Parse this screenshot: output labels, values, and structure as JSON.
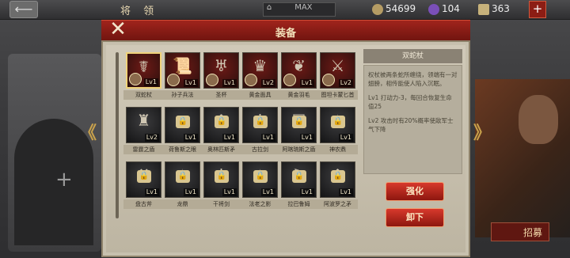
{
  "topbar": {
    "title": "将 领",
    "max_label": "MAX",
    "resources": [
      {
        "icon": "coin-icon",
        "value": "54699",
        "color": "#b59c64"
      },
      {
        "icon": "gem-icon",
        "value": "104",
        "color": "#7a4fb8"
      },
      {
        "icon": "ticket-icon",
        "value": "363",
        "color": "#c7b27b"
      }
    ],
    "back_glyph": "⟵",
    "plus_glyph": "+"
  },
  "dialog": {
    "title": "装备",
    "close_glyph": "✕"
  },
  "items": [
    {
      "name": "双蛇杖",
      "level": "Lv1",
      "locked": false,
      "portrait": true,
      "selected": true,
      "glyph": "☤"
    },
    {
      "name": "孙子兵法",
      "level": "Lv1",
      "locked": false,
      "portrait": true,
      "selected": false,
      "glyph": "📜"
    },
    {
      "name": "圣杯",
      "level": "Lv1",
      "locked": false,
      "portrait": true,
      "selected": false,
      "glyph": "♅"
    },
    {
      "name": "黄金面具",
      "level": "Lv2",
      "locked": false,
      "portrait": true,
      "selected": false,
      "glyph": "♛"
    },
    {
      "name": "黄金羽毛",
      "level": "Lv1",
      "locked": false,
      "portrait": true,
      "selected": false,
      "glyph": "❦"
    },
    {
      "name": "图坦卡蒙匕首",
      "level": "Lv2",
      "locked": false,
      "portrait": true,
      "selected": false,
      "glyph": "⚔"
    },
    {
      "name": "雷霆之盾",
      "level": "Lv2",
      "locked": false,
      "portrait": false,
      "selected": false,
      "glyph": "♜"
    },
    {
      "name": "荷鲁斯之眼",
      "level": "Lv1",
      "locked": true,
      "portrait": false,
      "selected": false,
      "glyph": "◉"
    },
    {
      "name": "奥林匹斯矛",
      "level": "Lv1",
      "locked": true,
      "portrait": false,
      "selected": false,
      "glyph": "↟"
    },
    {
      "name": "古拉剑",
      "level": "Lv1",
      "locked": true,
      "portrait": false,
      "selected": false,
      "glyph": "†"
    },
    {
      "name": "阿喀琉斯之盾",
      "level": "Lv1",
      "locked": true,
      "portrait": false,
      "selected": false,
      "glyph": "⛨"
    },
    {
      "name": "神农鼎",
      "level": "Lv1",
      "locked": true,
      "portrait": false,
      "selected": false,
      "glyph": "♨"
    },
    {
      "name": "盘古斧",
      "level": "Lv1",
      "locked": true,
      "portrait": false,
      "selected": false,
      "glyph": "⚒"
    },
    {
      "name": "龙鼎",
      "level": "Lv1",
      "locked": true,
      "portrait": false,
      "selected": false,
      "glyph": "♨"
    },
    {
      "name": "干将剑",
      "level": "Lv1",
      "locked": true,
      "portrait": false,
      "selected": false,
      "glyph": "†"
    },
    {
      "name": "法老之影",
      "level": "Lv1",
      "locked": true,
      "portrait": false,
      "selected": false,
      "glyph": "✧"
    },
    {
      "name": "拉巴鲁姆",
      "level": "Lv1",
      "locked": true,
      "portrait": false,
      "selected": false,
      "glyph": "⚑"
    },
    {
      "name": "阿波罗之矛",
      "level": "Lv1",
      "locked": true,
      "portrait": false,
      "selected": false,
      "glyph": "↟"
    }
  ],
  "detail": {
    "title": "双蛇杖",
    "description": "权杖被两条蛇所缠绕，领端有一对翅膀，相传能使人陷入沉眠。",
    "lv1": "Lv1 打动力-3，每回合恢复生命值25",
    "lv2": "Lv2 攻击时有20%概率使敌军士气下降"
  },
  "buttons": {
    "enhance": "强化",
    "unequip": "卸下",
    "recruit": "招募"
  },
  "side_arrows": {
    "left": "《",
    "right": "》"
  }
}
